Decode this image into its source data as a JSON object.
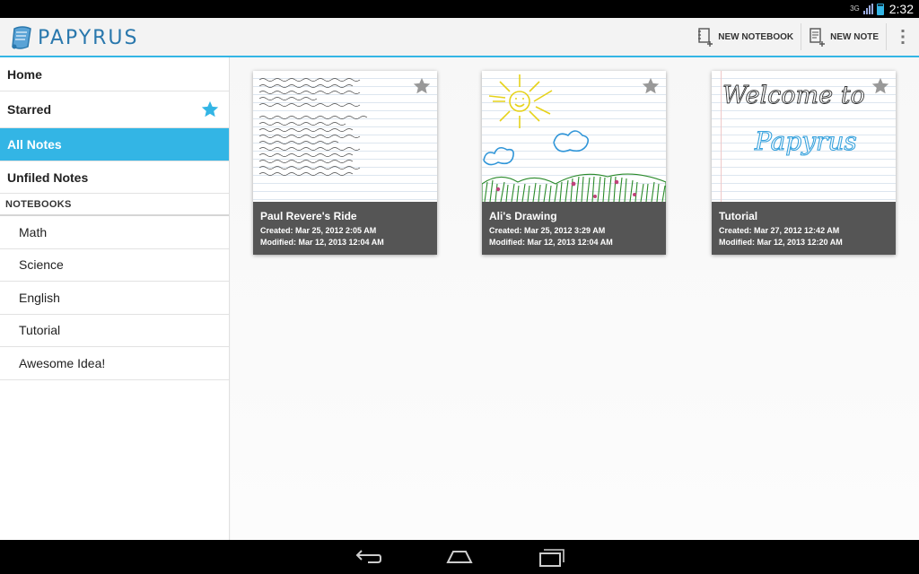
{
  "status_bar": {
    "network": "3G",
    "time": "2:32"
  },
  "app": {
    "name": "PAPYRUS"
  },
  "actions": {
    "new_notebook": "NEW NOTEBOOK",
    "new_note": "NEW NOTE"
  },
  "sidebar": {
    "items": [
      {
        "label": "Home"
      },
      {
        "label": "Starred"
      },
      {
        "label": "All Notes",
        "selected": true
      },
      {
        "label": "Unfiled Notes"
      }
    ],
    "notebooks_header": "NOTEBOOKS",
    "notebooks": [
      {
        "label": "Math"
      },
      {
        "label": "Science"
      },
      {
        "label": "English"
      },
      {
        "label": "Tutorial"
      },
      {
        "label": "Awesome Idea!"
      }
    ]
  },
  "notes": [
    {
      "title": "Paul Revere's Ride",
      "created": "Created: Mar 25, 2012 2:05 AM",
      "modified": "Modified: Mar 12, 2013 12:04 AM"
    },
    {
      "title": "Ali's Drawing",
      "created": "Created: Mar 25, 2012 3:29 AM",
      "modified": "Modified: Mar 12, 2013 12:04 AM"
    },
    {
      "title": "Tutorial",
      "created": "Created: Mar 27, 2012 12:42 AM",
      "modified": "Modified: Mar 12, 2013 12:20 AM"
    }
  ],
  "handwriting": {
    "welcome_line1": "Welcome to",
    "welcome_line2": "Papyrus"
  },
  "colors": {
    "accent": "#33b5e5",
    "brand": "#2a78ad",
    "card_footer": "#555555"
  }
}
